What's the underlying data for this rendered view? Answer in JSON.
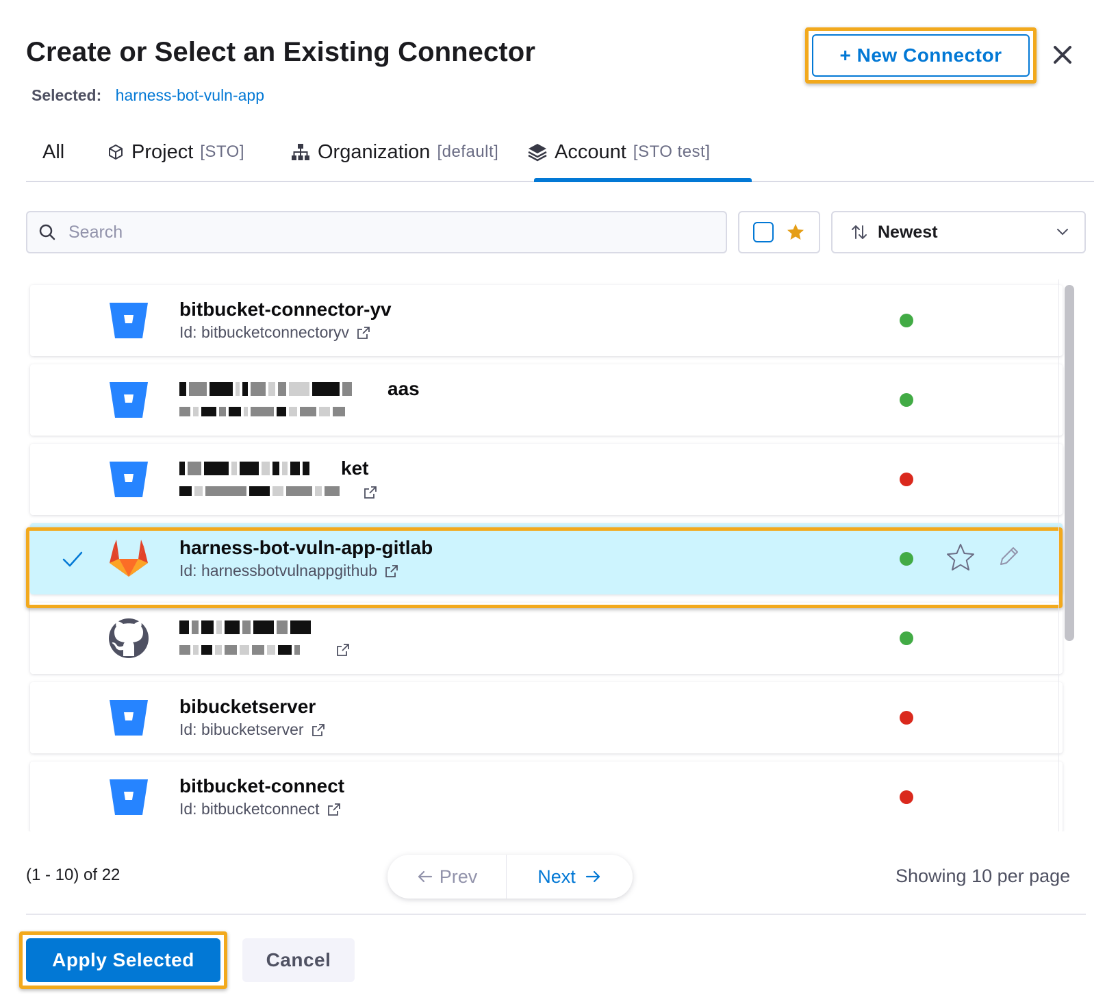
{
  "dialog": {
    "title": "Create or Select an Existing Connector",
    "selected_label": "Selected:",
    "selected_value": "harness-bot-vuln-app",
    "new_connector_label": "+ New Connector",
    "close_icon": "close-icon"
  },
  "tabs": [
    {
      "label": "All",
      "sub": "",
      "icon": ""
    },
    {
      "label": "Project",
      "sub": "[STO]",
      "icon": "cube-icon"
    },
    {
      "label": "Organization",
      "sub": "[default]",
      "icon": "org-tree-icon"
    },
    {
      "label": "Account",
      "sub": "[STO test]",
      "icon": "layers-icon",
      "active": true
    }
  ],
  "filters": {
    "search_placeholder": "Search",
    "sort_label": "Newest"
  },
  "connectors": [
    {
      "name": "bitbucket-connector-yv",
      "id_text": "Id: bitbucketconnectoryv",
      "type": "bitbucket",
      "status": "success",
      "status_color": "#42ab45"
    },
    {
      "name": "aas",
      "id_text": "",
      "type": "bitbucket",
      "status": "success",
      "status_color": "#42ab45",
      "redacted": true
    },
    {
      "name": "ket",
      "id_text": "",
      "type": "bitbucket",
      "status": "failure",
      "status_color": "#da291d",
      "redacted": true
    },
    {
      "name": "harness-bot-vuln-app-gitlab",
      "id_text": "Id: harnessbotvulnappgithub",
      "type": "gitlab",
      "status": "success",
      "status_color": "#42ab45",
      "selected": true
    },
    {
      "name": "",
      "id_text": "",
      "type": "github",
      "status": "success",
      "status_color": "#42ab45",
      "redacted": true
    },
    {
      "name": "bibucketserver",
      "id_text": "Id: bibucketserver",
      "type": "bitbucket",
      "status": "failure",
      "status_color": "#da291d"
    },
    {
      "name": "bitbucket-connect",
      "id_text": "Id: bitbucketconnect",
      "type": "bitbucket",
      "status": "failure",
      "status_color": "#da291d"
    }
  ],
  "pagination": {
    "count_text": "(1 - 10) of 22",
    "prev_label": "Prev",
    "next_label": "Next",
    "per_page_text": "Showing 10 per page"
  },
  "footer": {
    "apply_label": "Apply Selected",
    "cancel_label": "Cancel"
  },
  "colors": {
    "accent": "#0278d5",
    "highlight": "#f2a91d",
    "selected_row_bg": "#cdf4fe",
    "star": "#e59e16"
  }
}
